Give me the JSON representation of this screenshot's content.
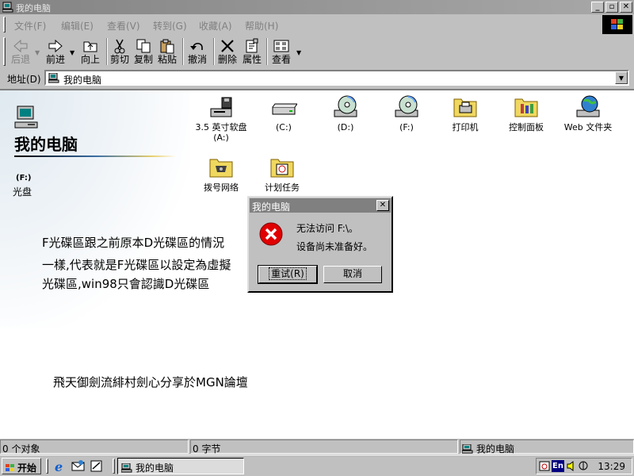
{
  "window": {
    "title": "我的电脑"
  },
  "menu": [
    "文件(F)",
    "编辑(E)",
    "查看(V)",
    "转到(G)",
    "收藏(A)",
    "帮助(H)"
  ],
  "toolbar": {
    "back": "后退",
    "forward": "前进",
    "up": "向上",
    "cut": "剪切",
    "copy": "复制",
    "paste": "粘贴",
    "undo": "撤消",
    "delete": "删除",
    "properties": "属性",
    "view": "查看"
  },
  "address": {
    "label": "地址(D)",
    "value": "我的电脑"
  },
  "folder": {
    "title": "我的电脑",
    "selected_drive": "(F:)",
    "selected_type": "光盘"
  },
  "items": [
    {
      "label": "3.5 英寸软盘\n(A:)",
      "icon": "floppy-drive-icon"
    },
    {
      "label": "(C:)",
      "icon": "hard-drive-icon"
    },
    {
      "label": "(D:)",
      "icon": "cd-drive-icon"
    },
    {
      "label": "(F:)",
      "icon": "cd-drive-icon"
    },
    {
      "label": "打印机",
      "icon": "printers-folder-icon"
    },
    {
      "label": "控制面板",
      "icon": "control-panel-icon"
    },
    {
      "label": "Web 文件夹",
      "icon": "web-folders-icon"
    },
    {
      "label": "拨号网络",
      "icon": "dialup-networking-icon"
    },
    {
      "label": "计划任务",
      "icon": "scheduled-tasks-icon"
    }
  ],
  "notes": {
    "line1": "F光碟區跟之前原本D光碟區的情況",
    "line2": "一樣,代表就是F光碟區以設定為虛擬",
    "line3": "光碟區,win98只會認識D光碟區",
    "credit": "飛天御劍流緋村劍心分享於MGN論壇"
  },
  "dialog": {
    "title": "我的电脑",
    "message1": "无法访问 F:\\。",
    "message2": "设备尚未准备好。",
    "retry": "重试(R)",
    "cancel": "取消"
  },
  "status": {
    "objects": "0 个对象",
    "bytes": "0 字节",
    "location": "我的电脑"
  },
  "taskbar": {
    "start": "开始",
    "task": "我的电脑",
    "clock": "13:29",
    "ime": "En"
  },
  "colors": {
    "desktop_gray": "#c0c0c0",
    "title_inactive": "#808080",
    "error_red": "#e00000"
  }
}
